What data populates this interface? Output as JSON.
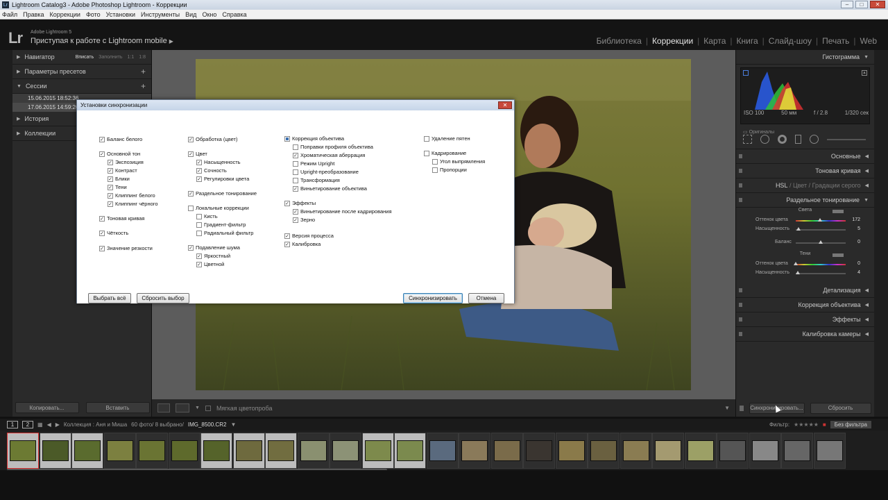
{
  "window": {
    "title": "Lightroom Catalog3 - Adobe Photoshop Lightroom - Коррекции",
    "app_icon": "Lr"
  },
  "menu": [
    "Файл",
    "Правка",
    "Коррекции",
    "Фото",
    "Установки",
    "Инструменты",
    "Вид",
    "Окно",
    "Справка"
  ],
  "identity": {
    "logo": "Lr",
    "product": "Adobe Lightroom 5",
    "mobile": "Приступая к работе с Lightroom mobile"
  },
  "modules": [
    "Библиотека",
    "Коррекции",
    "Карта",
    "Книга",
    "Слайд-шоу",
    "Печать",
    "Web"
  ],
  "modules_active": "Коррекции",
  "left_panel": {
    "navigator": "Навигатор",
    "nav_modes": [
      "Вписать",
      "Заполнить",
      "1:1",
      "1:8"
    ],
    "presets": "Параметры пресетов",
    "sessions": "Сессии",
    "session_items": [
      "15.06.2015 18:52:36",
      "17.06.2015 14:59:20"
    ],
    "history": "История",
    "collections": "Коллекции",
    "copy_btn": "Копировать...",
    "paste_btn": "Вставить"
  },
  "toolbar": {
    "softproof": "Мягкая цветопроба"
  },
  "right_panel": {
    "histogram": "Гистограмма",
    "iso": "ISO 100",
    "focal": "50 мм",
    "aperture": "f / 2.8",
    "shutter": "1/320 сек",
    "originals": "Оригиналы",
    "basic": "Основные",
    "tone_curve": "Тоновая кривая",
    "hsl": "HSL",
    "color": "Цвет",
    "grayscale": "Градации серого",
    "split_toning": "Раздельное тонирование",
    "highlights": "Света",
    "hue": "Оттенок цвета",
    "saturation": "Насыщенность",
    "balance": "Баланс",
    "shadows": "Тени",
    "hl_hue": "172",
    "hl_sat": "5",
    "bal_val": "0",
    "sh_hue": "0",
    "sh_sat": "4",
    "hl_hue_fraction": 0.48,
    "hl_sat_fraction": 0.05,
    "bal_fraction": 0.5,
    "sh_hue_fraction": 0.0,
    "sh_sat_fraction": 0.04,
    "detail": "Детализация",
    "lens": "Коррекция объектива",
    "effects": "Эффекты",
    "calibration": "Калибровка камеры",
    "sync_btn": "Синхронизировать...",
    "reset_btn": "Сбросить"
  },
  "filmstrip": {
    "page1": "1",
    "page2": "2",
    "path": "Коллекция : Аня и Миша",
    "count": "60 фото/ 8 выбрано/",
    "file": "IMG_8500.CR2",
    "filter_label": "Фильтр:",
    "filter_value": "Без фильтра"
  },
  "dialog": {
    "title": "Установки синхронизации",
    "select_all": "Выбрать всё",
    "reset_sel": "Сбросить выбор",
    "sync": "Синхронизировать",
    "cancel": "Отмена",
    "col1": [
      {
        "label": "Баланс белого",
        "checked": true
      },
      {
        "label": "Основной тон",
        "checked": true
      },
      {
        "label": "Экспозиция",
        "checked": true
      },
      {
        "label": "Контраст",
        "checked": true
      },
      {
        "label": "Блики",
        "checked": true
      },
      {
        "label": "Тени",
        "checked": true
      },
      {
        "label": "Клиппинг белого",
        "checked": true
      },
      {
        "label": "Клиппинг чёрного",
        "checked": true
      },
      {
        "label": "Тоновая кривая",
        "checked": true
      },
      {
        "label": "Чёткость",
        "checked": true
      },
      {
        "label": "Значение резкости",
        "checked": true
      }
    ],
    "col2": [
      {
        "label": "Обработка (цвет)",
        "checked": true
      },
      {
        "label": "Цвет",
        "checked": true
      },
      {
        "label": "Насыщенность",
        "checked": true
      },
      {
        "label": "Сочность",
        "checked": true
      },
      {
        "label": "Регулировки цвета",
        "checked": true
      },
      {
        "label": "Раздельное тонирование",
        "checked": true
      },
      {
        "label": "Локальные коррекции",
        "checked": false
      },
      {
        "label": "Кисть",
        "checked": false
      },
      {
        "label": "Градиент-фильтр",
        "checked": false
      },
      {
        "label": "Радиальный фильтр",
        "checked": false
      },
      {
        "label": "Подавление шума",
        "checked": true
      },
      {
        "label": "Яркостный",
        "checked": true
      },
      {
        "label": "Цветной",
        "checked": true
      }
    ],
    "col3": [
      {
        "label": "Коррекция объектива",
        "checked": "mixed"
      },
      {
        "label": "Поправки профиля объектива",
        "checked": false
      },
      {
        "label": "Хроматическая аберрация",
        "checked": true
      },
      {
        "label": "Режим Upright",
        "checked": false
      },
      {
        "label": "Upright-преобразование",
        "checked": false
      },
      {
        "label": "Трансформация",
        "checked": false
      },
      {
        "label": "Виньетирование объектива",
        "checked": true
      },
      {
        "label": "Эффекты",
        "checked": true
      },
      {
        "label": "Виньетирование после кадрирования",
        "checked": true
      },
      {
        "label": "Зерно",
        "checked": true
      },
      {
        "label": "Версия процесса",
        "checked": true
      },
      {
        "label": "Калибровка",
        "checked": true
      }
    ],
    "col4": [
      {
        "label": "Удаление пятен",
        "checked": false
      },
      {
        "label": "Кадрирование",
        "checked": false
      },
      {
        "label": "Угол выпрямления",
        "checked": false
      },
      {
        "label": "Пропорции",
        "checked": false
      }
    ]
  }
}
